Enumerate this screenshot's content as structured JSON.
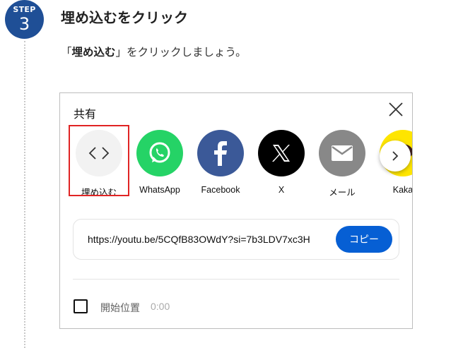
{
  "step": {
    "word": "STEP",
    "number": "3",
    "title": "埋め込むをクリック",
    "desc_open": "「",
    "desc_bold": "埋め込む",
    "desc_rest": "」をクリックしましょう。"
  },
  "dialog": {
    "title": "共有",
    "share_items": [
      {
        "label": "埋め込む",
        "icon": "embed-code-icon"
      },
      {
        "label": "WhatsApp",
        "icon": "whatsapp-icon",
        "color": "#25d366"
      },
      {
        "label": "Facebook",
        "icon": "facebook-icon",
        "color": "#3b5998"
      },
      {
        "label": "X",
        "icon": "x-logo-icon",
        "color": "#000000"
      },
      {
        "label": "メール",
        "icon": "mail-icon",
        "color": "#888888"
      },
      {
        "label": "Kaka",
        "icon": "kakaotalk-icon",
        "color": "#fee500"
      }
    ],
    "url": "https://youtu.be/5CQfB83OWdY?si=7b3LDV7xc3H",
    "copy_label": "コピー",
    "start_label": "開始位置",
    "start_time": "0:00"
  },
  "colors": {
    "step_badge": "#1f4f96",
    "highlight": "#e02424",
    "copy_button": "#065fd4"
  }
}
